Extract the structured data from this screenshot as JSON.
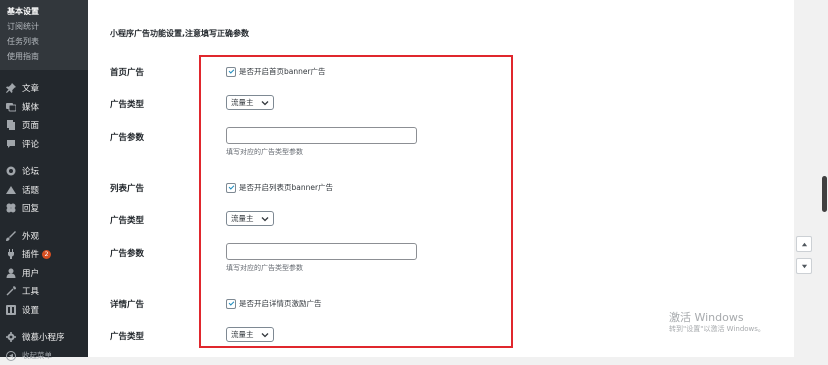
{
  "sidebar": {
    "submenu": [
      {
        "label": "基本设置",
        "current": true
      },
      {
        "label": "订阅统计",
        "current": false
      },
      {
        "label": "任务列表",
        "current": false
      },
      {
        "label": "使用指南",
        "current": false
      }
    ],
    "group1": [
      {
        "label": "文章",
        "icon": "pin-icon"
      },
      {
        "label": "媒体",
        "icon": "media-icon"
      },
      {
        "label": "页面",
        "icon": "page-icon"
      },
      {
        "label": "评论",
        "icon": "comment-icon"
      }
    ],
    "group2": [
      {
        "label": "论坛",
        "icon": "forum-icon"
      },
      {
        "label": "话题",
        "icon": "topic-icon"
      },
      {
        "label": "回复",
        "icon": "reply-icon"
      }
    ],
    "group3": [
      {
        "label": "外观",
        "icon": "appearance-icon"
      },
      {
        "label": "插件",
        "icon": "plugin-icon",
        "badge": "2"
      },
      {
        "label": "用户",
        "icon": "user-icon"
      },
      {
        "label": "工具",
        "icon": "tools-icon"
      },
      {
        "label": "设置",
        "icon": "settings-icon"
      }
    ],
    "group4": [
      {
        "label": "微慕小程序",
        "icon": "gear-icon"
      }
    ],
    "collapse_label": "收起菜单"
  },
  "main": {
    "section_title": "小程序广告功能设置,注意填写正确参数",
    "home_ad": {
      "label": "首页广告",
      "checkbox_label": "是否开启首页banner广告",
      "type_label": "广告类型",
      "type_value": "流量主",
      "param_label": "广告参数",
      "param_value": "",
      "param_hint": "填写对应的广告类型参数"
    },
    "list_ad": {
      "label": "列表广告",
      "checkbox_label": "是否开启列表页banner广告",
      "type_label": "广告类型",
      "type_value": "流量主",
      "param_label": "广告参数",
      "param_value": "",
      "param_hint": "填写对应的广告类型参数"
    },
    "detail_ad": {
      "label": "详情广告",
      "checkbox_label": "是否开启详情页激励广告",
      "type_label": "广告类型",
      "type_value": "流量主"
    }
  },
  "watermark": {
    "title": "激活 Windows",
    "subtitle": "转到\"设置\"以激活 Windows。"
  },
  "colors": {
    "sidebar_bg": "#23282d",
    "highlight_border": "#e0272d",
    "badge": "#d54e21"
  }
}
